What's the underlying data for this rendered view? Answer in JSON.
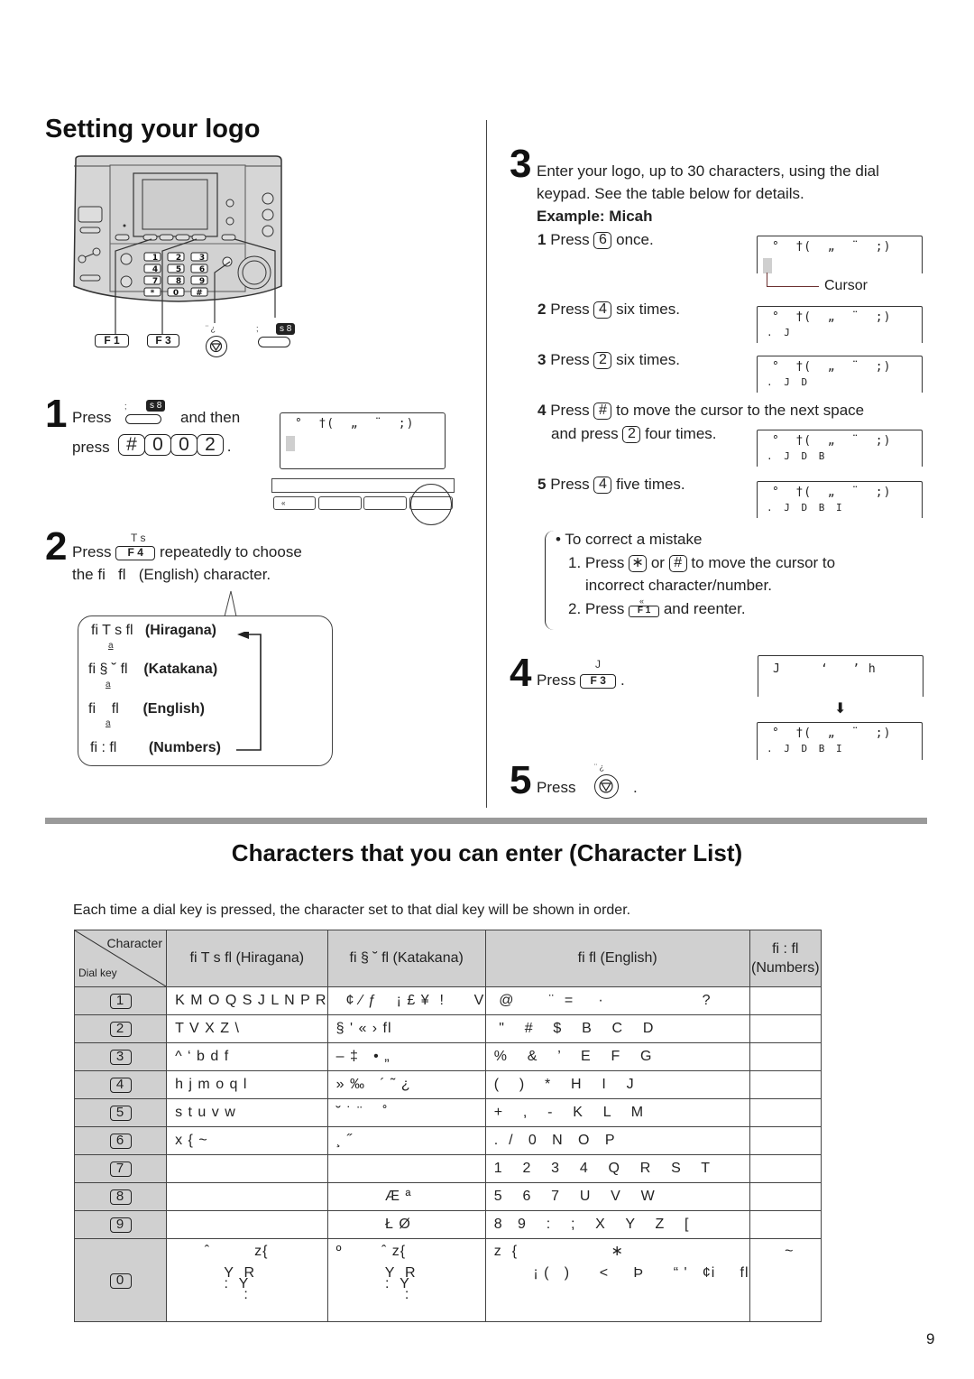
{
  "page_title": "Setting your logo",
  "device_labels": {
    "f1": "F 1",
    "f3": "F 3",
    "stop_mark": "¨ ¿",
    "menu_mark": ";",
    "menu_badge": "s 8"
  },
  "step1": {
    "number": "1",
    "text_press": "Press",
    "text_and_then": "and then",
    "text_press2": "press",
    "keys": [
      "#",
      "0",
      "0",
      "2"
    ],
    "period": ".",
    "badge": "s 8",
    "badge_mark": ";",
    "lcd_line1": "°  †(  „  ¨  ;)",
    "softkey_first": "«"
  },
  "step2": {
    "number": "2",
    "text_before": "Press",
    "key": "F 4",
    "key_mark": "T s",
    "text_after": "repeatedly to choose",
    "line2": "the fi   fl   (English) character.",
    "modes": [
      {
        "code": "fi T s fl",
        "name": "(Hiragana)",
        "sub": "a"
      },
      {
        "code": "fi § ˘ fl",
        "name": "(Katakana)",
        "sub": "a"
      },
      {
        "code": "fi    fl",
        "name": "(English)",
        "sub": "a"
      },
      {
        "code": "fi : fl",
        "name": "(Numbers)",
        "sub": ""
      }
    ]
  },
  "step3": {
    "number": "3",
    "text": "Enter your logo, up to 30 characters, using the dial",
    "text2": "keypad. See the table below for details.",
    "example": "Example: Micah",
    "cursor_label": "Cursor",
    "substeps": [
      {
        "num": "1",
        "press": "Press",
        "key": "6",
        "after": "once.",
        "lcd_line1": "°  †(  „  ¨  ;)",
        "lcd_line2": ","
      },
      {
        "num": "2",
        "press": "Press",
        "key": "4",
        "after": "six times.",
        "lcd_line1": "°  †(  „  ¨  ;)",
        "lcd_line2": ". J"
      },
      {
        "num": "3",
        "press": "Press",
        "key": "2",
        "after": "six times.",
        "lcd_line1": "°  †(  „  ¨  ;)",
        "lcd_line2": ". J D"
      },
      {
        "num": "4",
        "press": "Press",
        "key": "#",
        "after": "to move the cursor to the next space",
        "after2_a": "and press",
        "key2": "2",
        "after2_b": "four times.",
        "lcd_line1": "°  †(  „  ¨  ;)",
        "lcd_line2": ". J D B"
      },
      {
        "num": "5",
        "press": "Press",
        "key": "4",
        "after": "five times.",
        "lcd_line1": "°  †(  „  ¨  ;)",
        "lcd_line2": ". J D B I"
      }
    ],
    "correct": {
      "title": "• To correct a mistake",
      "s1_a": "1. Press",
      "s1_key1": "∗",
      "s1_or": "or",
      "s1_key2": "#",
      "s1_b": "to move the cursor to",
      "s1_c": "incorrect character/number.",
      "s2_a": "2. Press",
      "s2_key": "F 1",
      "s2_mark": "«",
      "s2_b": "and reenter."
    }
  },
  "step4": {
    "number": "4",
    "text": "Press",
    "key": "F 3",
    "key_mark": "J",
    "period": ".",
    "lcd_before": "J     ‘   ’ h",
    "lcd_after_line1": "°  †(  „  ¨  ;)",
    "lcd_after_line2": ". J D B I"
  },
  "step5": {
    "number": "5",
    "text": "Press",
    "key_mark": "¨ ¿",
    "period": "."
  },
  "character_list": {
    "title": "Characters that you can enter (Character List)",
    "intro": "Each time a dial key is pressed, the character set to that dial key will be shown in order.",
    "corner_top": "Character",
    "corner_bottom": "Dial key",
    "headers": [
      "fi T s fl   (Hiragana)",
      "fi § ˘ fl   (Katakana)",
      "fi   fl   (English)",
      "fi : fl\n(Numbers)"
    ],
    "rows": [
      {
        "key": "1",
        "hiragana": "K M O Q S J L N P R",
        "katakana": "  ¢ ⁄ ƒ    ¡ £ ¥  !      V",
        "english": " @       ¨  =     ·                    ?",
        "numbers": ""
      },
      {
        "key": "2",
        "hiragana": "T V X Z \\",
        "katakana": "§ ' « › fl",
        "english": " \"    #    $    B    C    D",
        "numbers": ""
      },
      {
        "key": "3",
        "hiragana": "^ ‘ b d f",
        "katakana": "– ‡   • „",
        "english": "%    &    ’    E    F    G",
        "numbers": ""
      },
      {
        "key": "4",
        "hiragana": "h j m o q l",
        "katakana": "» ‰   ´ ˜ ¿",
        "english": "(    )    *    H    I    J",
        "numbers": ""
      },
      {
        "key": "5",
        "hiragana": "s t u v w",
        "katakana": "˘ ˙ ¨    ˚",
        "english": "+    ,    -    K    L    M",
        "numbers": ""
      },
      {
        "key": "6",
        "hiragana": "x { ~",
        "katakana": "¸ ˝",
        "english": ".  /   0   N   O   P",
        "numbers": ""
      },
      {
        "key": "7",
        "hiragana": "",
        "katakana": "",
        "english": "1    2    3    4    Q    R    S    T",
        "numbers": ""
      },
      {
        "key": "8",
        "hiragana": "",
        "katakana": "          Æ ª",
        "english": "5    6    7    U    V    W",
        "numbers": ""
      },
      {
        "key": "9",
        "hiragana": "",
        "katakana": "          Ł Ø",
        "english": "8   9    :    ;    X    Y    Z    [",
        "numbers": ""
      },
      {
        "key": "0",
        "hiragana": "      ˆ         z{\n\n          Y  R\n          :  Y\n              :",
        "katakana": "º        ˆ z{\n\n          Y  R\n          :  Y\n              :",
        "english": "z  {                   ∗\n\n        ¡ (   )      <     Þ      “ '   ¢i     fl",
        "numbers": "~"
      }
    ]
  },
  "page_number": "9"
}
